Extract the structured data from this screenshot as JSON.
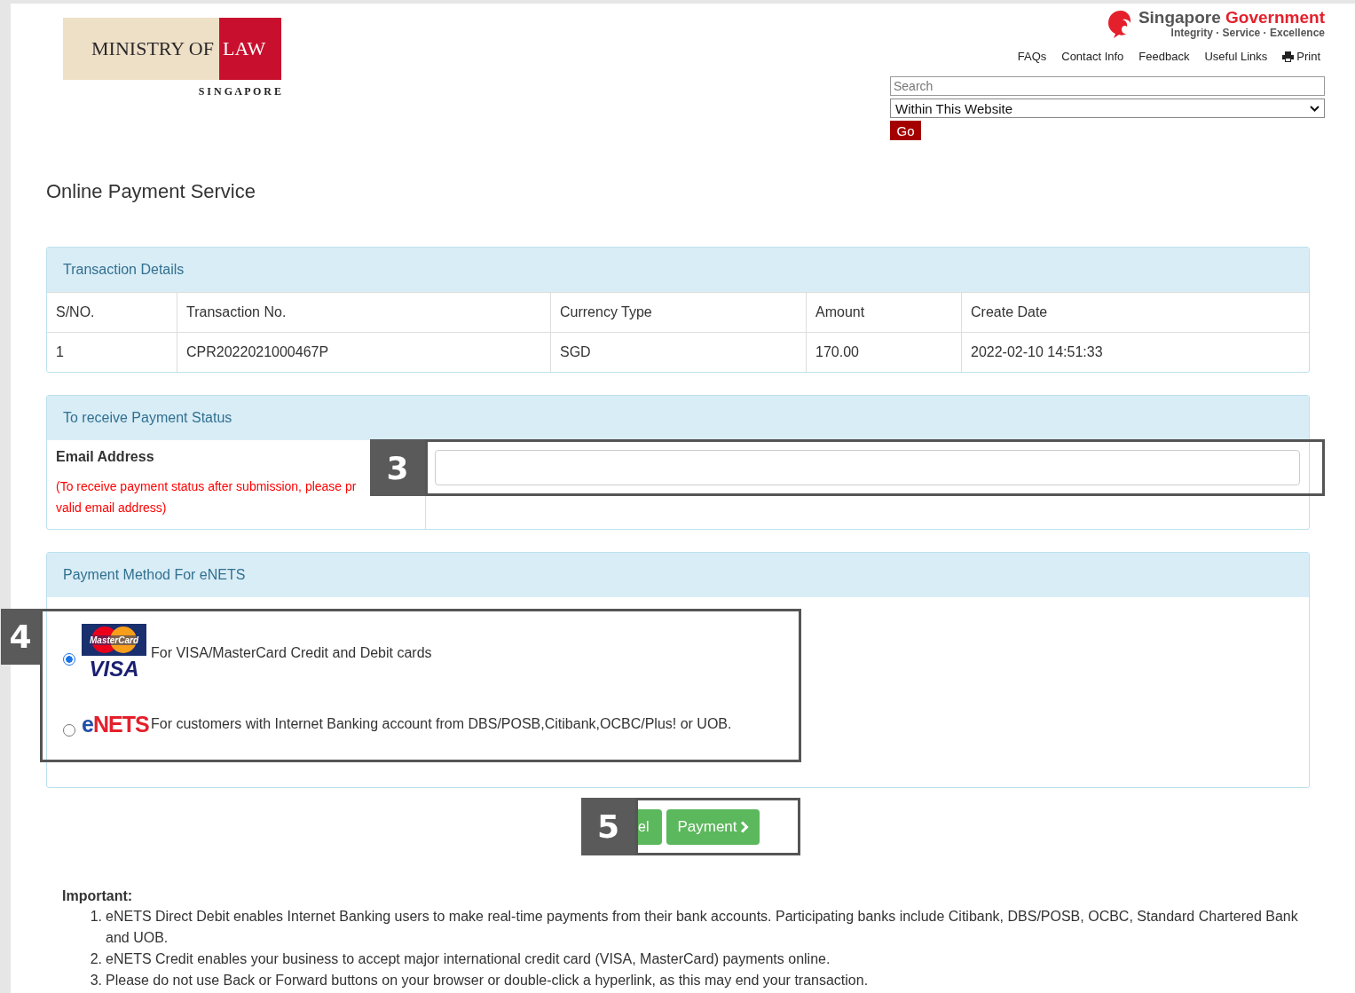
{
  "header": {
    "ministry_logo": {
      "line": "MINISTRY OF",
      "accent": "LAW",
      "country": "S I N G A P O R E"
    },
    "gov_logo": {
      "name": "Singapore",
      "accent": "Government",
      "tagline": "Integrity · Service · Excellence"
    },
    "nav_links": [
      "FAQs",
      "Contact Info",
      "Feedback",
      "Useful Links",
      "Print"
    ],
    "search": {
      "placeholder": "Search"
    },
    "scope_select": {
      "value": "Within This Website"
    },
    "go_button": "Go"
  },
  "page_title": "Online Payment Service",
  "transaction": {
    "title": "Transaction Details",
    "columns": [
      "S/NO.",
      "Transaction No.",
      "Currency Type",
      "Amount",
      "Create Date"
    ],
    "rows": [
      [
        "1",
        "CPR2022021000467P",
        "SGD",
        "170.00",
        "2022-02-10 14:51:33"
      ]
    ]
  },
  "email": {
    "title": "To receive Payment Status",
    "label": "Email Address",
    "hint_lines": [
      "(To receive payment status after submission, please pr",
      "valid email address)"
    ]
  },
  "payment": {
    "title": "Payment Method For eNETS",
    "options": [
      {
        "kind": "card",
        "selected": true,
        "logo_texts": [
          "MasterCard",
          "VISA"
        ],
        "label": "For VISA/MasterCard Credit and Debit cards"
      },
      {
        "kind": "enets",
        "selected": false,
        "logo_texts": [
          "e",
          "NETS"
        ],
        "label": "For customers with Internet Banking account from DBS/POSB,Citibank,OCBC/Plus! or UOB."
      }
    ]
  },
  "buttons": {
    "cancel": "el",
    "pay": "Payment"
  },
  "important": {
    "heading": "Important:",
    "items": [
      {
        "number": "1.",
        "text": "eNETS Direct Debit enables Internet Banking users to make real-time payments from their bank accounts. Participating banks include Citibank, DBS/POSB, OCBC, Standard Chartered Bank and UOB."
      },
      {
        "number": "2.",
        "text": "eNETS Credit enables your business to accept major international credit card (VISA, MasterCard) payments online."
      },
      {
        "number": "3.",
        "text": "Please do not use Back or Forward buttons on your browser or double-click a hyperlink, as this may end your transaction."
      }
    ]
  },
  "callouts": [
    "3",
    "4",
    "5"
  ]
}
